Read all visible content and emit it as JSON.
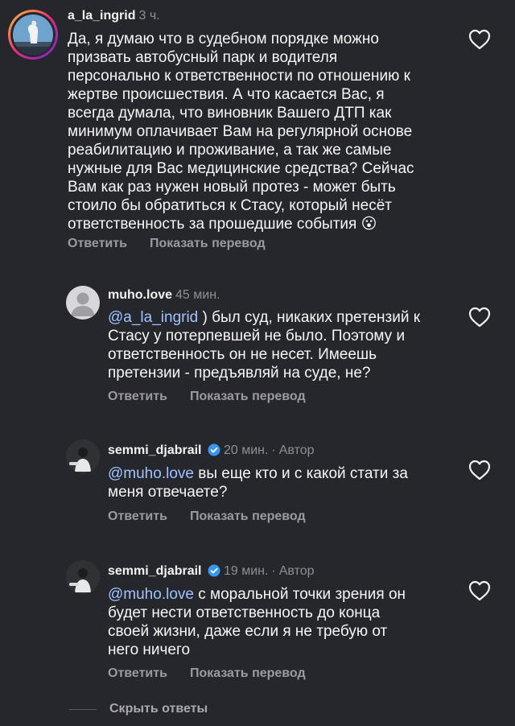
{
  "comments": [
    {
      "username": "a_la_ingrid",
      "time": "3 ч.",
      "lines": [
        "Да, я думаю что в судебном порядке можно",
        "призвать автобусный парк и водителя",
        "персонально к ответственности по отношению к",
        "жертве происшествия. А что касается Вас, я",
        "всегда думала, что виновник Вашего ДТП как",
        "минимум оплачивает Вам на регулярной основе",
        "реабилитацию и проживание, а так же самые",
        "нужные для Вас медицинские средства? Сейчас",
        "Вам как раз нужен новый протез - может быть",
        "стоило бы обратиться к Стасу, который несёт",
        "ответственность за прошедшие события"
      ],
      "emoji": "😮",
      "reply": "Ответить",
      "translate": "Показать перевод"
    },
    {
      "username": "muho.love",
      "time": "45 мин.",
      "mention": "@a_la_ingrid",
      "first_line_rest": " ) был суд, никаких претензий к",
      "lines": [
        "Стасу у потерпевшей не было.  Поэтому и",
        "ответственность он не несет. Имеешь",
        "претензии - предъявляй на суде, не?"
      ],
      "reply": "Ответить",
      "translate": "Показать перевод"
    },
    {
      "username": "semmi_djabrail",
      "time": "20 мин.",
      "author": "Автор",
      "mention": "@muho.love",
      "first_line_rest": " вы еще кто и с какой стати за",
      "lines": [
        "меня отвечаете?"
      ],
      "reply": "Ответить",
      "translate": "Показать перевод"
    },
    {
      "username": "semmi_djabrail",
      "time": "19 мин.",
      "author": "Автор",
      "mention": "@muho.love",
      "first_line_rest": " с моральной точки зрения он",
      "lines": [
        "будет нести ответственность до конца",
        "своей жизни, даже если я не требую от",
        "него ничего"
      ],
      "reply": "Ответить",
      "translate": "Показать перевод"
    }
  ],
  "hide_replies": "Скрыть ответы",
  "dot": "·",
  "icons": {
    "like": "heart-outline-icon",
    "verified": "verified-badge-icon",
    "default_avatar": "default-avatar-icon"
  },
  "colors": {
    "background": "#26272c",
    "mention": "#9fc3ff",
    "verified": "#3897f0",
    "secondary_text": "#9a9aa0"
  }
}
